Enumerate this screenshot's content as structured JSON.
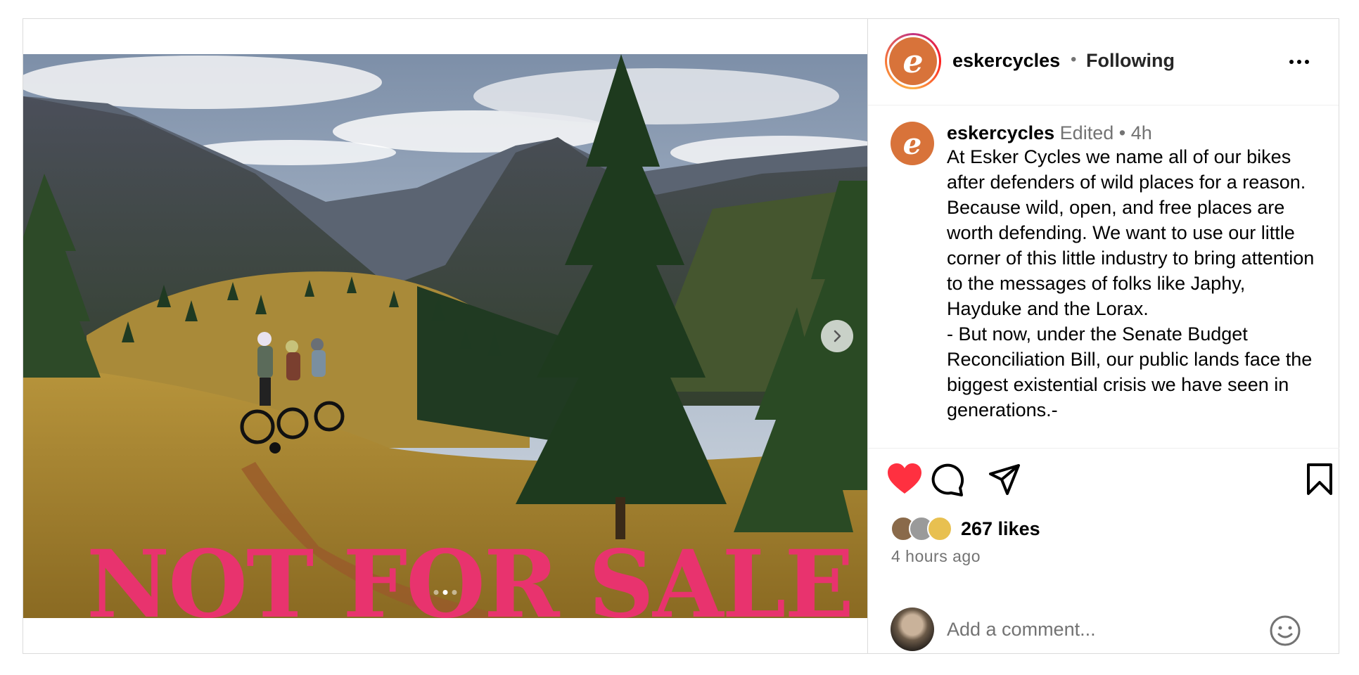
{
  "post": {
    "banner_text": "NOT FOR SALE",
    "carousel": {
      "count": 3,
      "active_index": 1
    }
  },
  "header": {
    "username": "eskercycles",
    "separator": "•",
    "follow_status": "Following",
    "more_icon": "more-horizontal-icon"
  },
  "caption": {
    "username": "eskercycles",
    "edited": "Edited",
    "separator": "•",
    "time": "4h",
    "text": "At Esker Cycles we name all of our bikes after defenders of wild places for a reason. Because wild, open, and free places are worth defending. We want to use our little corner of this little industry to bring attention to the messages of folks like Japhy, Hayduke and the Lorax.\n- But now, under the Senate Budget Reconciliation Bill, our public lands face the biggest existential crisis we have seen in generations.-"
  },
  "actions": {
    "liked": true,
    "like_color": "#ff3040",
    "icons": [
      "heart-icon",
      "comment-icon",
      "share-icon",
      "bookmark-icon"
    ],
    "likes_text": "267 likes",
    "time_ago": "4 hours ago"
  },
  "comment": {
    "placeholder": "Add a comment...",
    "emoji_icon": "emoji-icon"
  },
  "colors": {
    "brand": "#d8733a",
    "banner": "#e8336e",
    "secondary_text": "#737373",
    "border": "#dbdbdb"
  }
}
